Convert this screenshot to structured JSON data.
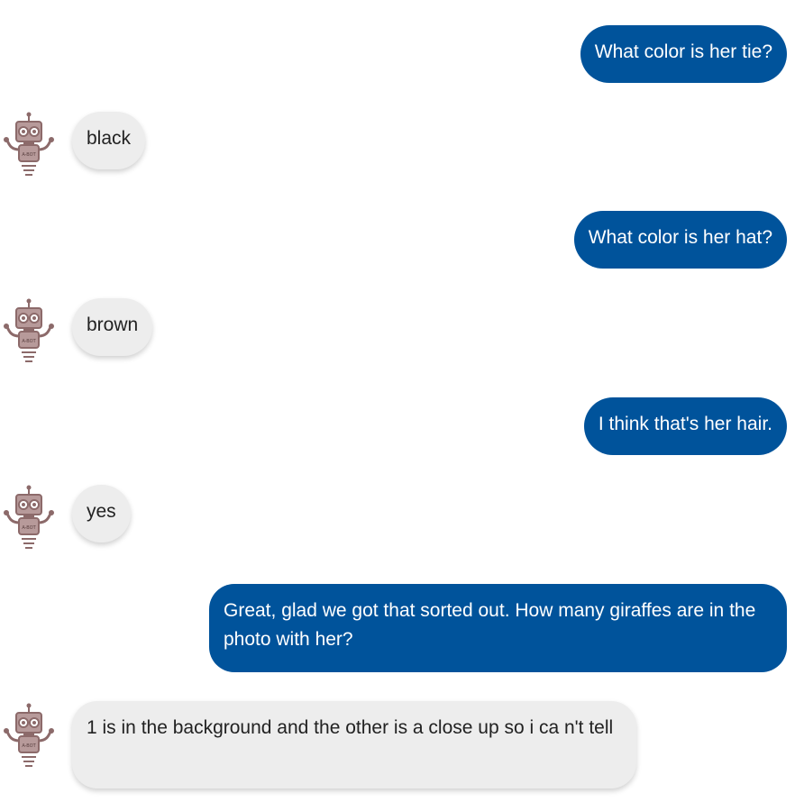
{
  "colors": {
    "user_bubble": "#00539b",
    "bot_bubble": "#ededed",
    "robot": "#8c6a6a"
  },
  "avatar": {
    "icon": "robot-icon",
    "label": "A-BOT"
  },
  "messages": [
    {
      "role": "user",
      "text": "What color is her tie?"
    },
    {
      "role": "bot",
      "text": "black"
    },
    {
      "role": "user",
      "text": "What color is her hat?"
    },
    {
      "role": "bot",
      "text": "brown"
    },
    {
      "role": "user",
      "text": "I think that's her hair."
    },
    {
      "role": "bot",
      "text": "yes"
    },
    {
      "role": "user",
      "text": "Great, glad we got that sorted out. How many giraffes are in the photo with her?"
    },
    {
      "role": "bot",
      "text": "1 is in the background and the other is a close up so i ca n't tell"
    }
  ]
}
